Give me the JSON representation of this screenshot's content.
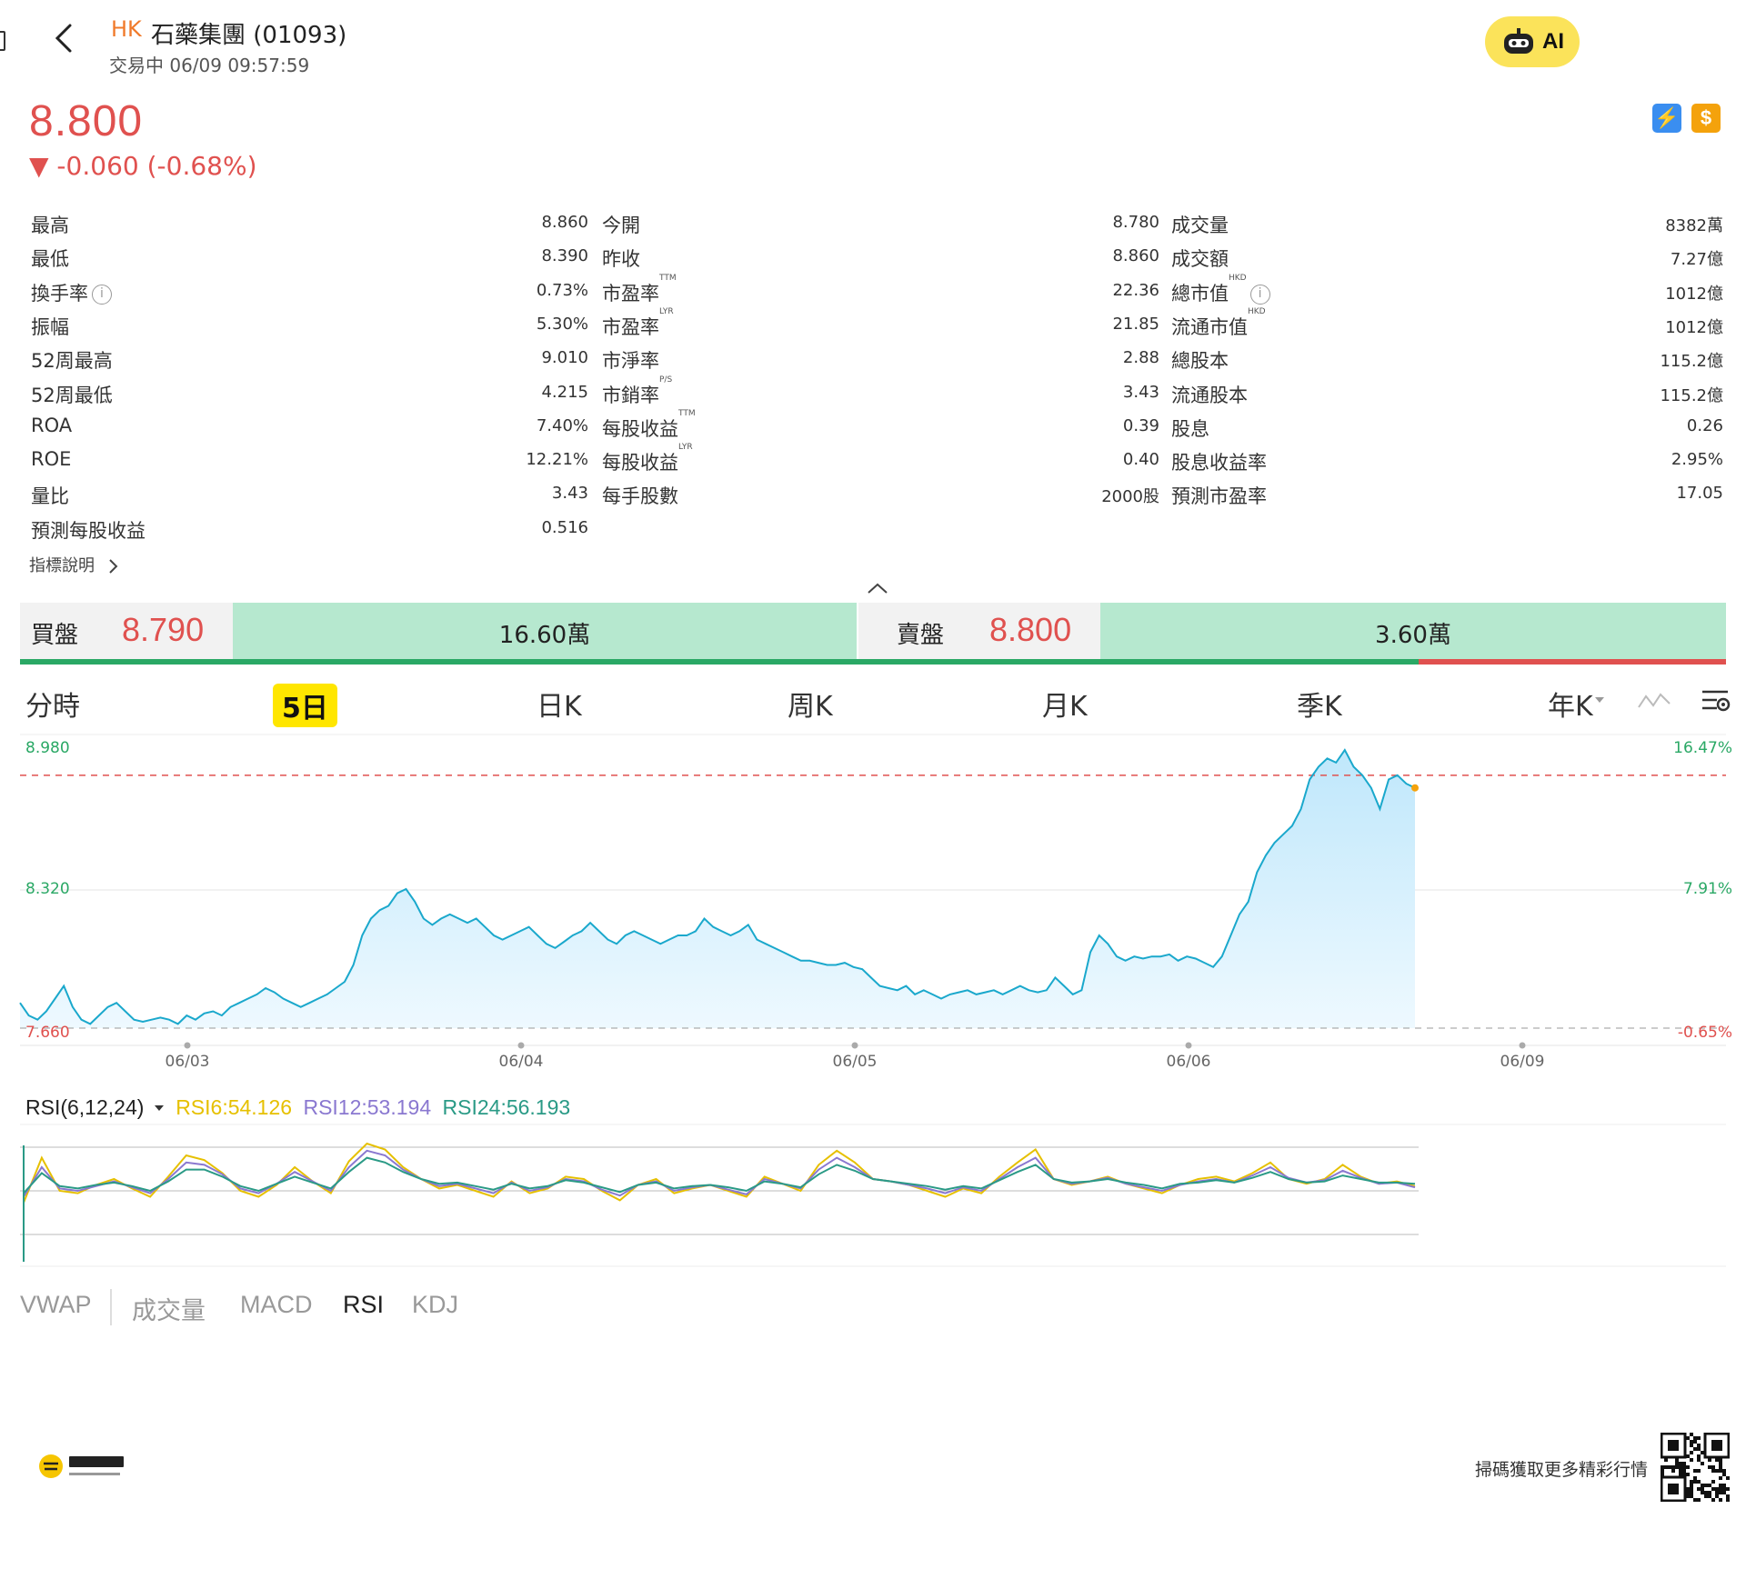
{
  "header": {
    "market": "HK",
    "title": "石藥集團 (01093)",
    "status": "交易中 06/09 09:57:59",
    "ai_label": "AI"
  },
  "quote": {
    "price": "8.800",
    "change": "▼ -0.060 (-0.68%)",
    "badges": [
      "⚡",
      "$"
    ]
  },
  "stats": [
    [
      {
        "label": "最高",
        "value": "8.860"
      },
      {
        "label": "今開",
        "value": "8.780"
      },
      {
        "label": "成交量",
        "value": "8382萬"
      }
    ],
    [
      {
        "label": "最低",
        "value": "8.390"
      },
      {
        "label": "昨收",
        "value": "8.860"
      },
      {
        "label": "成交額",
        "value": "7.27億"
      }
    ],
    [
      {
        "label": "換手率",
        "value": "0.73%",
        "info": true
      },
      {
        "label": "市盈率",
        "sup": "TTM",
        "value": "22.36"
      },
      {
        "label": "總市值",
        "sup": "HKD",
        "value": "1012億",
        "info": true
      }
    ],
    [
      {
        "label": "振幅",
        "value": "5.30%"
      },
      {
        "label": "市盈率",
        "sup": "LYR",
        "value": "21.85"
      },
      {
        "label": "流通市值",
        "sup": "HKD",
        "value": "1012億"
      }
    ],
    [
      {
        "label": "52周最高",
        "value": "9.010"
      },
      {
        "label": "市淨率",
        "value": "2.88"
      },
      {
        "label": "總股本",
        "value": "115.2億"
      }
    ],
    [
      {
        "label": "52周最低",
        "value": "4.215"
      },
      {
        "label": "市銷率",
        "sup": "P/S",
        "value": "3.43"
      },
      {
        "label": "流通股本",
        "value": "115.2億"
      }
    ],
    [
      {
        "label": "ROA",
        "value": "7.40%"
      },
      {
        "label": "每股收益",
        "sup": "TTM",
        "value": "0.39"
      },
      {
        "label": "股息",
        "value": "0.26"
      }
    ],
    [
      {
        "label": "ROE",
        "value": "12.21%"
      },
      {
        "label": "每股收益",
        "sup": "LYR",
        "value": "0.40"
      },
      {
        "label": "股息收益率",
        "value": "2.95%"
      }
    ],
    [
      {
        "label": "量比",
        "value": "3.43"
      },
      {
        "label": "每手股數",
        "value": "2000股"
      },
      {
        "label": "預測市盈率",
        "value": "17.05"
      }
    ],
    [
      {
        "label": "預測每股收益",
        "value": "0.516"
      }
    ]
  ],
  "guide_label": "指標說明",
  "orderbook": {
    "bid_label": "買盤",
    "bid_price": "8.790",
    "bid_volume": "16.60萬",
    "ask_label": "賣盤",
    "ask_price": "8.800",
    "ask_volume": "3.60萬",
    "bid_ratio": 0.82
  },
  "tabs": [
    "分時",
    "5日",
    "日K",
    "周K",
    "月K",
    "季K",
    "年K"
  ],
  "active_tab": "5日",
  "indicator_tabs": [
    "VWAP",
    "成交量",
    "MACD",
    "RSI",
    "KDJ"
  ],
  "active_indicator": "RSI",
  "rsi_header": {
    "name": "RSI(6,12,24)",
    "rsi6": "RSI6:54.126",
    "rsi12": "RSI12:53.194",
    "rsi24": "RSI24:56.193"
  },
  "colors": {
    "up": "#e0514f",
    "down": "#2aa865",
    "line": "#1aa8cc",
    "rsi6": "#e6c000",
    "rsi12": "#8a78d0",
    "rsi24": "#2a9a86"
  },
  "chart_data": [
    {
      "type": "line",
      "title": "",
      "x_ticks": [
        "06/03",
        "06/04",
        "06/05",
        "06/06",
        "06/09"
      ],
      "left_axis_ticks": [
        "8.980",
        "8.320",
        "7.660"
      ],
      "right_axis_ticks": [
        "16.47%",
        "7.91%",
        "-0.65%"
      ],
      "ylim": [
        7.66,
        8.98
      ],
      "reference_close": 8.86,
      "series": [
        {
          "values": [
            7.78,
            7.72,
            7.7,
            7.74,
            7.8,
            7.86,
            7.76,
            7.7,
            7.68,
            7.72,
            7.76,
            7.78,
            7.74,
            7.7,
            7.69,
            7.7,
            7.71,
            7.7,
            7.68,
            7.72,
            7.7,
            7.73,
            7.74,
            7.72,
            7.76,
            7.78,
            7.8,
            7.82,
            7.85,
            7.83,
            7.8,
            7.78,
            7.76,
            7.78,
            7.8,
            7.82,
            7.85,
            7.88,
            7.96,
            8.1,
            8.18,
            8.22,
            8.24,
            8.3,
            8.32,
            8.26,
            8.18,
            8.15,
            8.18,
            8.2,
            8.18,
            8.16,
            8.18,
            8.14,
            8.1,
            8.08,
            8.1,
            8.12,
            8.14,
            8.1,
            8.06,
            8.04,
            8.07,
            8.1,
            8.12,
            8.16,
            8.12,
            8.08,
            8.06,
            8.1,
            8.12,
            8.1,
            8.08,
            8.06,
            8.08,
            8.1,
            8.1,
            8.12,
            8.18,
            8.14,
            8.12,
            8.1,
            8.12,
            8.15,
            8.08,
            8.06,
            8.04,
            8.02,
            8.0,
            7.98,
            7.98,
            7.97,
            7.96,
            7.96,
            7.97,
            7.95,
            7.94,
            7.9,
            7.86,
            7.85,
            7.84,
            7.86,
            7.82,
            7.84,
            7.82,
            7.8,
            7.82,
            7.83,
            7.84,
            7.82,
            7.83,
            7.84,
            7.82,
            7.84,
            7.86,
            7.84,
            7.83,
            7.84,
            7.9,
            7.86,
            7.82,
            7.84,
            8.02,
            8.1,
            8.06,
            8.0,
            7.98,
            8.0,
            7.99,
            8.0,
            8.0,
            8.01,
            7.98,
            8.0,
            7.99,
            7.97,
            7.95,
            8.0,
            8.1,
            8.2,
            8.26,
            8.4,
            8.48,
            8.54,
            8.58,
            8.62,
            8.7,
            8.84,
            8.9,
            8.94,
            8.92,
            8.98,
            8.9,
            8.86,
            8.8,
            8.7,
            8.84,
            8.86,
            8.82,
            8.8
          ]
        }
      ]
    },
    {
      "type": "line",
      "title": "",
      "series": [
        {
          "name": "RSI6",
          "values": [
            40,
            78,
            50,
            48,
            55,
            60,
            52,
            45,
            62,
            80,
            76,
            65,
            50,
            45,
            55,
            70,
            58,
            48,
            75,
            90,
            85,
            70,
            60,
            52,
            55,
            50,
            45,
            58,
            48,
            52,
            62,
            60,
            50,
            42,
            55,
            60,
            48,
            52,
            55,
            50,
            45,
            62,
            56,
            50,
            72,
            84,
            74,
            60,
            58,
            55,
            50,
            45,
            52,
            48,
            62,
            74,
            85,
            60,
            55,
            58,
            62,
            56,
            52,
            48,
            55,
            60,
            62,
            58,
            65,
            74,
            60,
            56,
            60,
            72,
            62,
            56,
            58,
            54
          ]
        },
        {
          "name": "RSI12",
          "values": [
            45,
            70,
            52,
            50,
            54,
            58,
            53,
            48,
            60,
            74,
            72,
            64,
            52,
            48,
            56,
            66,
            58,
            50,
            70,
            84,
            80,
            68,
            60,
            54,
            56,
            52,
            48,
            57,
            50,
            53,
            60,
            58,
            51,
            46,
            55,
            58,
            50,
            53,
            55,
            51,
            47,
            60,
            56,
            52,
            68,
            78,
            70,
            60,
            58,
            55,
            52,
            48,
            53,
            50,
            60,
            70,
            78,
            60,
            56,
            58,
            61,
            56,
            53,
            50,
            55,
            58,
            60,
            57,
            63,
            70,
            61,
            57,
            59,
            67,
            61,
            56,
            57,
            53
          ]
        },
        {
          "name": "RSI24",
          "values": [
            48,
            65,
            54,
            52,
            55,
            57,
            54,
            50,
            58,
            68,
            68,
            62,
            54,
            50,
            56,
            62,
            57,
            52,
            66,
            78,
            74,
            66,
            60,
            56,
            57,
            54,
            51,
            56,
            52,
            54,
            59,
            57,
            53,
            49,
            55,
            57,
            52,
            54,
            55,
            53,
            50,
            58,
            56,
            53,
            64,
            72,
            67,
            60,
            58,
            56,
            54,
            51,
            54,
            52,
            59,
            66,
            72,
            60,
            57,
            58,
            60,
            57,
            55,
            52,
            56,
            57,
            59,
            57,
            61,
            66,
            60,
            57,
            58,
            63,
            60,
            57,
            57,
            56
          ]
        }
      ]
    }
  ]
}
